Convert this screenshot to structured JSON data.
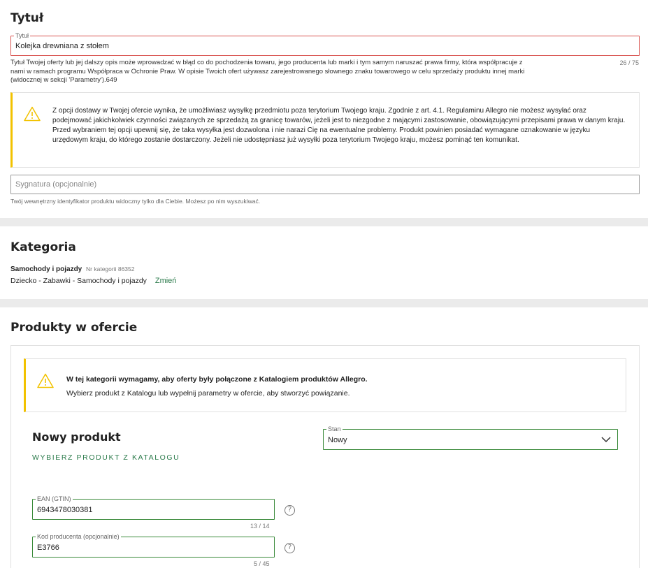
{
  "title_section": {
    "heading": "Tytuł",
    "field_legend": "Tytuł",
    "field_value": "Kolejka drewniana z stołem",
    "counter": "26 / 75",
    "error_text": "Tytuł Twojej oferty lub jej dalszy opis może wprowadzać w błąd co do pochodzenia towaru, jego producenta lub marki i tym samym naruszać prawa firmy, która współpracuje z nami w ramach programu Współpraca w Ochronie Praw. W opisie Twoich ofert używasz zarejestrowanego słownego znaku towarowego w celu sprzedaży produktu innej marki (widocznej w sekcji 'Parametry').649",
    "warning_text": "Z opcji dostawy w Twojej ofercie wynika, że umożliwiasz wysyłkę przedmiotu poza terytorium Twojego kraju. Zgodnie z art. 4.1. Regulaminu Allegro nie możesz wysyłać oraz podejmować jakichkolwiek czynności związanych ze sprzedażą za granicę towarów, jeżeli jest to niezgodne z mającymi zastosowanie, obowiązującymi przepisami prawa w danym kraju. Przed wybraniem tej opcji upewnij się, że taka wysyłka jest dozwolona i nie narazi Cię na ewentualne problemy. Produkt powinien posiadać wymagane oznakowanie w języku urzędowym kraju, do którego zostanie dostarczony. Jeżeli nie udostępniasz już wysyłki poza terytorium Twojego kraju, możesz pominąć ten komunikat.",
    "signature_placeholder": "Sygnatura (opcjonalnie)",
    "signature_help": "Twój wewnętrzny identyfikator produktu widoczny tylko dla Ciebie. Możesz po nim wyszukiwać."
  },
  "category_section": {
    "heading": "Kategoria",
    "category_name": "Samochody i pojazdy",
    "category_number": "Nr kategorii 86352",
    "path": "Dziecko - Zabawki - Samochody i pojazdy",
    "change_link": "Zmień"
  },
  "products_section": {
    "heading": "Produkty w ofercie",
    "info_bold": "W tej kategorii wymagamy, aby oferty były połączone z Katalogiem produktów Allegro.",
    "info_text": "Wybierz produkt z Katalogu lub wypełnij parametry w ofercie, aby stworzyć powiązanie.",
    "new_product_heading": "Nowy produkt",
    "choose_catalog_link": "WYBIERZ PRODUKT Z KATALOGU",
    "state_legend": "Stan",
    "state_value": "Nowy",
    "ean_legend": "EAN (GTIN)",
    "ean_value": "6943478030381",
    "ean_counter": "13 / 14",
    "producer_code_legend": "Kod producenta (opcjonalnie)",
    "producer_code_value": "E3766",
    "producer_code_counter": "5 / 45",
    "help_icon_glyph": "?"
  },
  "colors": {
    "accent_green": "#2a7a4a",
    "error_red": "#d9534f",
    "warning_yellow": "#f2c200",
    "valid_green": "#3a8a3a"
  }
}
